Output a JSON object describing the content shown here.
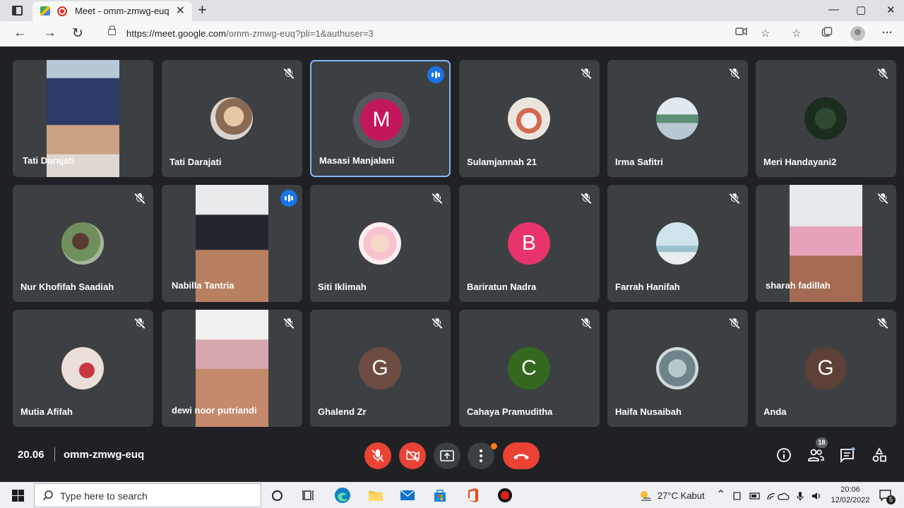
{
  "browser": {
    "tab_title": "Meet - omm-zmwg-euq",
    "tab_close": "✕",
    "new_tab": "+",
    "url_host": "https://meet.google.com",
    "url_path": "/omm-zmwg-euq?pli=1&authuser=3",
    "window_controls": [
      "—",
      "▢",
      "✕"
    ]
  },
  "participants": [
    {
      "name": "Tati Darajati",
      "kind": "video",
      "muted": false,
      "speaking": false
    },
    {
      "name": "Tati Darajati",
      "kind": "photo",
      "muted": true,
      "speaking": false
    },
    {
      "name": "Masasi Manjalani",
      "kind": "initial",
      "initial": "M",
      "color": "#c2185b",
      "muted": false,
      "speaking": true,
      "active": true
    },
    {
      "name": "Sulamjannah 21",
      "kind": "photo",
      "muted": true,
      "speaking": false
    },
    {
      "name": "Irma Safitri",
      "kind": "photo",
      "muted": true,
      "speaking": false
    },
    {
      "name": "Meri Handayani2",
      "kind": "photo",
      "muted": true,
      "speaking": false
    },
    {
      "name": "Nur Khofifah Saadiah",
      "kind": "photo",
      "muted": true,
      "speaking": false
    },
    {
      "name": "Nabilla Tantria",
      "kind": "video",
      "muted": false,
      "speaking": true
    },
    {
      "name": "Siti Iklimah",
      "kind": "photo",
      "muted": true,
      "speaking": false
    },
    {
      "name": "Bariratun Nadra",
      "kind": "initial",
      "initial": "B",
      "color": "#e8336d",
      "muted": true,
      "speaking": false
    },
    {
      "name": "Farrah Hanifah",
      "kind": "photo",
      "muted": true,
      "speaking": false
    },
    {
      "name": "sharah fadillah",
      "kind": "video",
      "muted": true,
      "speaking": false
    },
    {
      "name": "Mutia Afifah",
      "kind": "photo",
      "muted": true,
      "speaking": false
    },
    {
      "name": "dewi noor putriandi",
      "kind": "video",
      "muted": true,
      "speaking": false
    },
    {
      "name": "Ghalend Zr",
      "kind": "initial",
      "initial": "G",
      "color": "#6d4c41",
      "muted": true,
      "speaking": false
    },
    {
      "name": "Cahaya Pramuditha",
      "kind": "initial",
      "initial": "C",
      "color": "#33691e",
      "muted": true,
      "speaking": false
    },
    {
      "name": "Haifa Nusaibah",
      "kind": "photo",
      "muted": true,
      "speaking": false
    },
    {
      "name": "Anda",
      "kind": "initial",
      "initial": "G",
      "color": "#5d4037",
      "muted": true,
      "speaking": false
    }
  ],
  "meeting": {
    "time": "20.06",
    "code": "omm-zmwg-euq",
    "participant_count": "18"
  },
  "taskbar": {
    "search_placeholder": "Type here to search",
    "weather": "27°C  Kabut",
    "time": "20:06",
    "date": "12/02/2022",
    "notif_count": "5"
  }
}
